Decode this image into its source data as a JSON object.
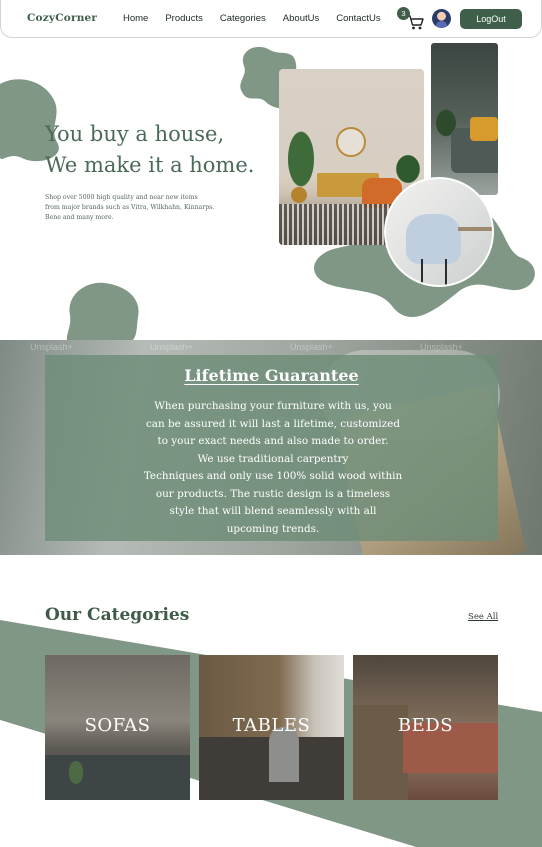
{
  "nav": {
    "brand": "CozyCorner",
    "links": [
      "Home",
      "Products",
      "Categories",
      "AboutUs",
      "ContactUs"
    ],
    "cart_count": "3",
    "logout_label": "LogOut"
  },
  "hero": {
    "headline_line1": "You buy a house,",
    "headline_line2": "We make it a home.",
    "subtext_line1": "Shop over 5000 high quality and near new items",
    "subtext_line2": "from major brands such as Vitra, Wilkhahn, Kinnarps.",
    "subtext_line3": "Bene and many more."
  },
  "lifetime": {
    "title": "Lifetime Guarantee",
    "lines": [
      "When purchasing your furniture with us, you",
      "can be assured it will last a lifetime, customized",
      "to your exact needs and also made to order.",
      "We use traditional carpentry",
      "Techniques and only use 100% solid wood within",
      "our products. The rustic design is a timeless",
      "style that will blend seamlessly with all",
      "upcoming trends."
    ],
    "watermark": "Unsplash+"
  },
  "categories": {
    "title": "Our Categories",
    "see_all": "See All",
    "items": [
      {
        "label": "SOFAS"
      },
      {
        "label": "TABLES"
      },
      {
        "label": "BEDS"
      }
    ]
  },
  "colors": {
    "brand_green": "#3f5f4a",
    "blob_green": "#809786",
    "text_green": "#4b6a57"
  }
}
